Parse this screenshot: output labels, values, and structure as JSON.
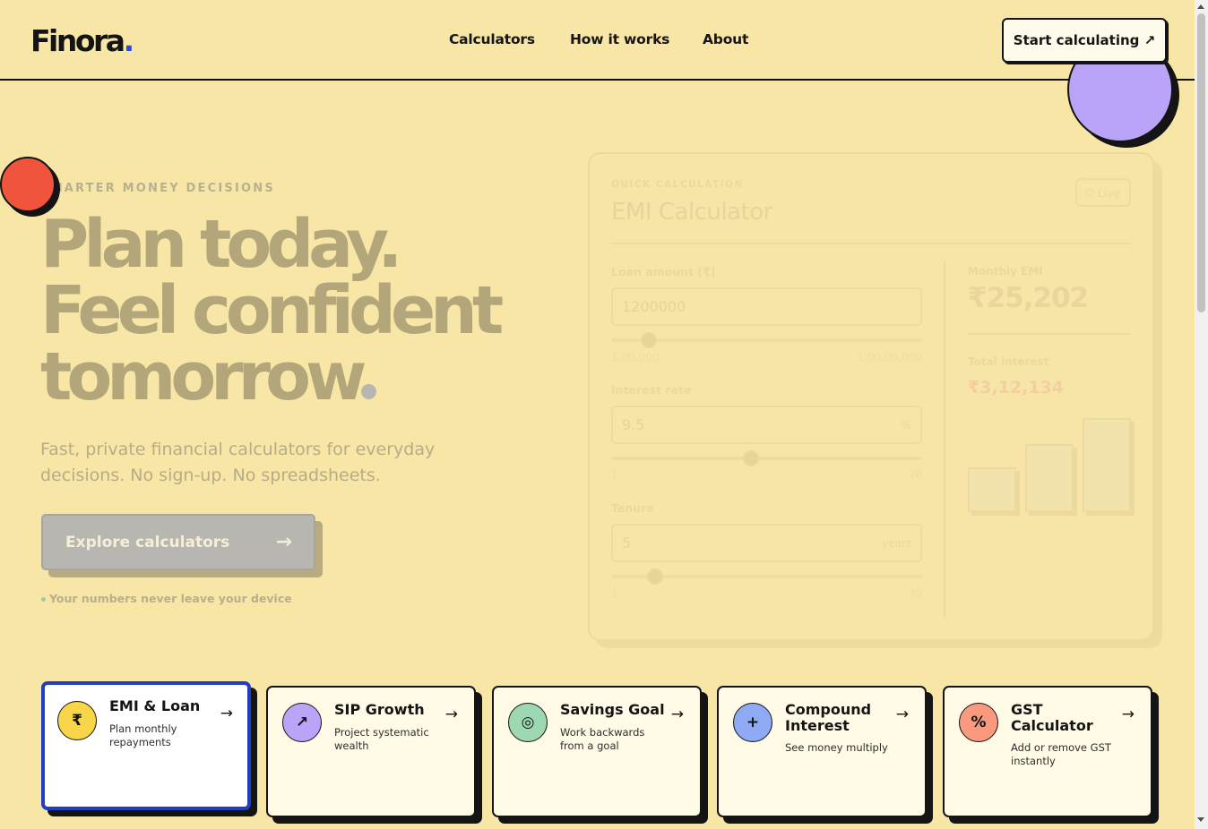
{
  "header": {
    "logo_text": "Finora",
    "logo_dot": ".",
    "nav": [
      "Calculators",
      "How it works",
      "About"
    ],
    "cta_label": "Start calculating ↗"
  },
  "hero": {
    "eyebrow": "SMARTER MONEY DECISIONS",
    "title_line1": "Plan today.",
    "title_line2": "Feel confident",
    "title_line3": "tomorrow",
    "subtitle": "Fast, private financial calculators for everyday decisions. No sign-up. No spreadsheets.",
    "explore_label": "Explore calculators",
    "explore_arrow": "→",
    "privacy_note": "Your numbers never leave your device"
  },
  "calculator": {
    "eyebrow": "QUICK CALCULATION",
    "title": "EMI Calculator",
    "live_badge": "Live",
    "loan_label": "Loan amount (₹)",
    "loan_value": "1200000",
    "loan_min": "1,00,000",
    "loan_max": "1,00,00,000",
    "loan_fraction": 0.12,
    "rate_label": "Interest rate",
    "rate_value": "9.5",
    "rate_unit": "%",
    "rate_min": "1",
    "rate_max": "20",
    "rate_fraction": 0.45,
    "tenure_label": "Tenure",
    "tenure_value": "5",
    "tenure_unit": "years",
    "tenure_min": "1",
    "tenure_max": "30",
    "tenure_fraction": 0.14,
    "emi_label": "Monthly EMI",
    "emi_value": "₹25,202",
    "interest_label": "Total interest",
    "interest_value": "₹3,12,134"
  },
  "cards": [
    {
      "icon": "₹",
      "icon_name": "rupee-icon",
      "color": "#f9d54a",
      "title": "EMI & Loan",
      "desc": "Plan monthly repayments",
      "arrow": "→",
      "active": true
    },
    {
      "icon": "↗",
      "icon_name": "trend-arrow-icon",
      "color": "#b9a4f7",
      "title": "SIP Growth",
      "desc": "Project systematic wealth",
      "arrow": "→",
      "active": false
    },
    {
      "icon": "◎",
      "icon_name": "target-icon",
      "color": "#9ed8b3",
      "title": "Savings Goal",
      "desc": "Work backwards from a goal",
      "arrow": "→",
      "active": false
    },
    {
      "icon": "+",
      "icon_name": "plus-icon",
      "color": "#8fa9f3",
      "title": "Compound Interest",
      "desc": "See money multiply",
      "arrow": "→",
      "active": false
    },
    {
      "icon": "%",
      "icon_name": "percent-icon",
      "color": "#f99a80",
      "title": "GST Calculator",
      "desc": "Add or remove GST instantly",
      "arrow": "→",
      "active": false
    }
  ],
  "colors": {
    "background": "#f8e6a6",
    "accent_blue": "#2b4ad8",
    "ink": "#141414"
  }
}
